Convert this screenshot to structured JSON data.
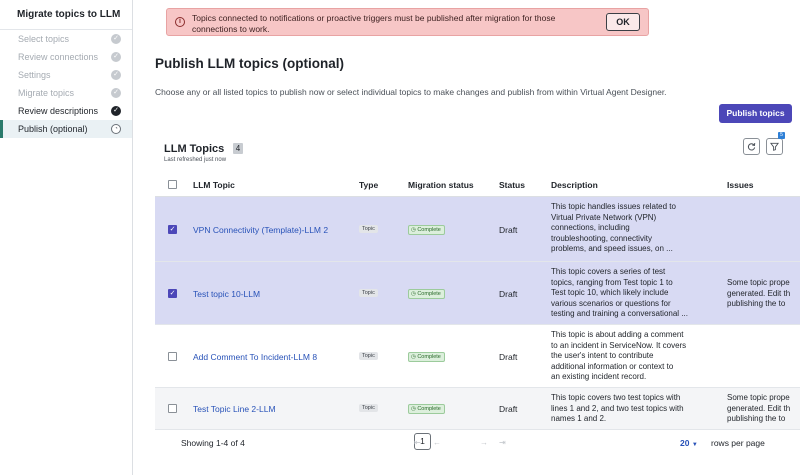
{
  "sidebar": {
    "title": "Migrate topics to LLM",
    "steps": [
      {
        "label": "Select topics",
        "state": "done"
      },
      {
        "label": "Review connections",
        "state": "done"
      },
      {
        "label": "Settings",
        "state": "done"
      },
      {
        "label": "Migrate topics",
        "state": "done"
      },
      {
        "label": "Review descriptions",
        "state": "current"
      },
      {
        "label": "Publish (optional)",
        "state": "active"
      }
    ]
  },
  "banner": {
    "text": "Topics connected to notifications or proactive triggers must be published after migration for those connections to work.",
    "ok_label": "OK"
  },
  "main": {
    "title": "Publish LLM topics (optional)",
    "subtitle": "Choose any or all listed topics to publish now or select individual topics to make changes and publish from within Virtual Agent Designer.",
    "publish_button": "Publish topics"
  },
  "table": {
    "title": "LLM Topics",
    "count": "4",
    "refreshed": "Last refreshed just now",
    "filter_badge": "5",
    "columns": {
      "topic": "LLM Topic",
      "type": "Type",
      "migration": "Migration status",
      "status": "Status",
      "description": "Description",
      "issues": "Issues"
    },
    "rows": [
      {
        "topic": "VPN Connectivity (Template)-LLM 2",
        "type": "Topic",
        "migration": "Complete",
        "status": "Draft",
        "description": [
          "This topic handles issues related to",
          "Virtual Private Network (VPN)",
          "connections, including",
          "troubleshooting, connectivity",
          "problems, and speed issues, on ..."
        ],
        "issues": []
      },
      {
        "topic": "Test topic 10-LLM",
        "type": "Topic",
        "migration": "Complete",
        "status": "Draft",
        "description": [
          "This topic covers a series of test",
          "topics, ranging from Test topic 1 to",
          "Test topic 10, which likely include",
          "various scenarios or questions for",
          "testing and training a conversational ..."
        ],
        "issues": [
          "Some topic prope",
          "generated. Edit th",
          "publishing the to"
        ]
      },
      {
        "topic": "Add Comment To Incident-LLM 8",
        "type": "Topic",
        "migration": "Complete",
        "status": "Draft",
        "description": [
          "This topic is about adding a comment",
          "to an incident in ServiceNow. It covers",
          "the user's intent to contribute",
          "additional information or context to",
          "an existing incident record."
        ],
        "issues": []
      },
      {
        "topic": "Test Topic Line 2-LLM",
        "type": "Topic",
        "migration": "Complete",
        "status": "Draft",
        "description": [
          "This topic covers two test topics with",
          "lines 1 and 2, and two test topics with",
          "names 1 and 2."
        ],
        "issues": [
          "Some topic prope",
          "generated. Edit th",
          "publishing the to"
        ]
      }
    ],
    "footer": {
      "showing": "Showing 1-4 of 4",
      "page": "1",
      "rows_per_page_value": "20",
      "rows_per_page_label": "rows per page"
    }
  },
  "colors": {
    "accent": "#4c47b8",
    "selected_row": "#d8daf3",
    "banner_bg": "#f7c6c6",
    "link": "#2852b8",
    "complete_badge": "#dcefdc"
  }
}
